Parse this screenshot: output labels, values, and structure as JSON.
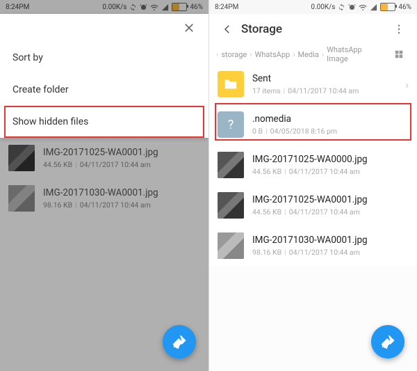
{
  "status": {
    "time": "8:24PM",
    "net_speed": "0.00K/s",
    "battery_pct": "46%"
  },
  "left": {
    "menu": {
      "sort_by": "Sort by",
      "create_folder": "Create folder",
      "show_hidden": "Show hidden files"
    },
    "rows": [
      {
        "name": "IMG-20171025-WA0001.jpg",
        "size": "44.56 KB",
        "date": "04/11/2017 10:44 am",
        "style": "a"
      },
      {
        "name": "IMG-20171030-WA0001.jpg",
        "size": "98.16 KB",
        "date": "04/11/2017 10:44 am",
        "style": "b"
      }
    ]
  },
  "right": {
    "title": "Storage",
    "breadcrumb": [
      "storage",
      "WhatsApp",
      "Media",
      "WhatsApp Image"
    ],
    "rows": [
      {
        "kind": "folder",
        "name": "Sent",
        "meta_a": "17 items",
        "meta_b": "04/11/2017 10:44 am"
      },
      {
        "kind": "nomedia",
        "name": ".nomedia",
        "meta_a": "0 B",
        "meta_b": "04/05/2018 8:16 pm"
      },
      {
        "kind": "img_a",
        "name": "IMG-20171025-WA0000.jpg",
        "meta_a": "44.56 KB",
        "meta_b": "04/11/2017 10:44 am"
      },
      {
        "kind": "img_a",
        "name": "IMG-20171025-WA0001.jpg",
        "meta_a": "44.56 KB",
        "meta_b": "04/11/2017 10:44 am"
      },
      {
        "kind": "img_b",
        "name": "IMG-20171030-WA0001.jpg",
        "meta_a": "98.16 KB",
        "meta_b": "04/11/2017 10:44 am"
      }
    ]
  }
}
